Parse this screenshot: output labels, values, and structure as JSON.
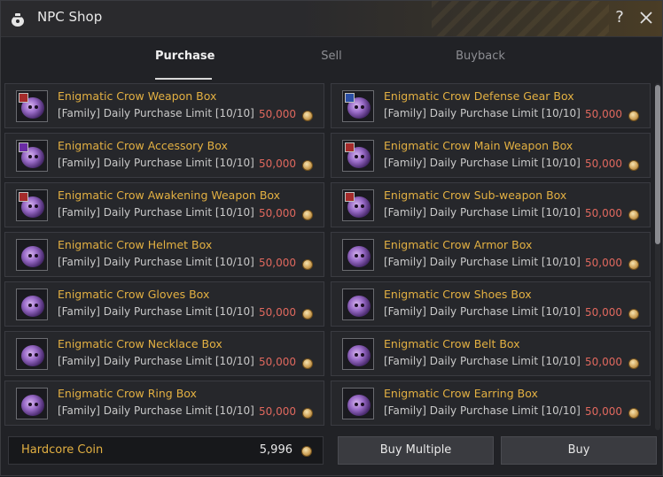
{
  "window": {
    "title": "NPC Shop",
    "help_label": "?"
  },
  "tabs": [
    {
      "label": "Purchase",
      "active": true
    },
    {
      "label": "Sell",
      "active": false
    },
    {
      "label": "Buyback",
      "active": false
    }
  ],
  "items": [
    {
      "name": "Enigmatic Crow Weapon Box",
      "limit": "[Family] Daily Purchase Limit [10/10]",
      "price": "50,000",
      "badge": "red"
    },
    {
      "name": "Enigmatic Crow Defense Gear Box",
      "limit": "[Family] Daily Purchase Limit [10/10]",
      "price": "50,000",
      "badge": "blue"
    },
    {
      "name": "Enigmatic Crow Accessory Box",
      "limit": "[Family] Daily Purchase Limit [10/10]",
      "price": "50,000",
      "badge": "purple"
    },
    {
      "name": "Enigmatic Crow Main Weapon Box",
      "limit": "[Family] Daily Purchase Limit [10/10]",
      "price": "50,000",
      "badge": "red"
    },
    {
      "name": "Enigmatic Crow Awakening Weapon Box",
      "limit": "[Family] Daily Purchase Limit [10/10]",
      "price": "50,000",
      "badge": "red"
    },
    {
      "name": "Enigmatic Crow Sub-weapon Box",
      "limit": "[Family] Daily Purchase Limit [10/10]",
      "price": "50,000",
      "badge": "red"
    },
    {
      "name": "Enigmatic Crow Helmet Box",
      "limit": "[Family] Daily Purchase Limit [10/10]",
      "price": "50,000",
      "badge": "none"
    },
    {
      "name": "Enigmatic Crow Armor Box",
      "limit": "[Family] Daily Purchase Limit [10/10]",
      "price": "50,000",
      "badge": "none"
    },
    {
      "name": "Enigmatic Crow Gloves Box",
      "limit": "[Family] Daily Purchase Limit [10/10]",
      "price": "50,000",
      "badge": "none"
    },
    {
      "name": "Enigmatic Crow Shoes Box",
      "limit": "[Family] Daily Purchase Limit [10/10]",
      "price": "50,000",
      "badge": "none"
    },
    {
      "name": "Enigmatic Crow Necklace Box",
      "limit": "[Family] Daily Purchase Limit [10/10]",
      "price": "50,000",
      "badge": "none"
    },
    {
      "name": "Enigmatic Crow Belt Box",
      "limit": "[Family] Daily Purchase Limit [10/10]",
      "price": "50,000",
      "badge": "none"
    },
    {
      "name": "Enigmatic Crow Ring Box",
      "limit": "[Family] Daily Purchase Limit [10/10]",
      "price": "50,000",
      "badge": "none"
    },
    {
      "name": "Enigmatic Crow Earring Box",
      "limit": "[Family] Daily Purchase Limit [10/10]",
      "price": "50,000",
      "badge": "none"
    }
  ],
  "footer": {
    "currency_label": "Hardcore Coin",
    "currency_value": "5,996",
    "buy_multiple_label": "Buy Multiple",
    "buy_label": "Buy"
  },
  "colors": {
    "item_name": "#e3b042",
    "price": "#e0685e",
    "accent_tab_underline": "#d8d8d8"
  },
  "icons": {
    "title": "coin-pouch-icon",
    "help": "help-icon",
    "close": "close-icon",
    "currency": "coin-icon",
    "item": "crow-box-icon"
  }
}
